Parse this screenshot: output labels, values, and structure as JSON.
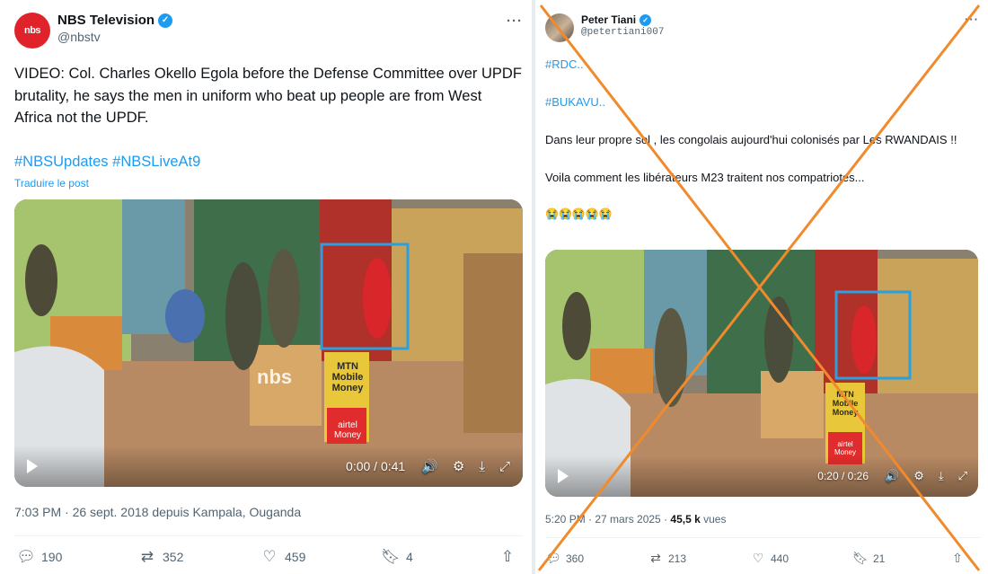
{
  "tweet_left": {
    "avatar_text": "nbs",
    "display_name": "NBS Television",
    "handle": "@nbstv",
    "text": "VIDEO: Col.  Charles Okello Egola before the Defense Committee over UPDF brutality, he says the men in uniform who beat up people are from West Africa not the UPDF.",
    "hashtags": "#NBSUpdates #NBSLiveAt9",
    "translate_label": "Traduire le post",
    "media": {
      "watermark": "nbs",
      "kiosk_lines": [
        "MTN",
        "Mobile",
        "Money"
      ],
      "kiosk_bottom": [
        "airtel",
        "Money"
      ],
      "time": "0:00 / 0:41",
      "highlight_color": "#2aa0e0"
    },
    "meta": "7:03 PM · 26 sept. 2018 depuis Kampala, Ouganda",
    "actions": {
      "replies": "190",
      "reposts": "352",
      "likes": "459",
      "bookmarks": "4"
    }
  },
  "tweet_right": {
    "display_name": "Peter Tiani",
    "handle": "@petertiani007",
    "lines": [
      "#RDC..",
      "#BUKAVU..",
      "Dans leur propre sol , les congolais aujourd'hui colonisés par Les RWANDAIS !!",
      "Voila comment les libérateurs M23 traitent nos compatriotes...",
      "😭😭😭😭😭"
    ],
    "media": {
      "kiosk_lines": [
        "MTN",
        "Mobile",
        "Money"
      ],
      "kiosk_bottom": [
        "airtel",
        "Money"
      ],
      "time": "0:20 / 0:26"
    },
    "meta_time": "5:20 PM · 27 mars 2025 · ",
    "views_count": "45,5 k",
    "views_label": " vues",
    "actions": {
      "replies": "360",
      "reposts": "213",
      "likes": "440",
      "bookmarks": "21"
    },
    "cross_color": "#f08a2c"
  },
  "colors": {
    "accent": "#1d9bf0",
    "muted": "#536471",
    "nbs_red": "#e0222b"
  }
}
